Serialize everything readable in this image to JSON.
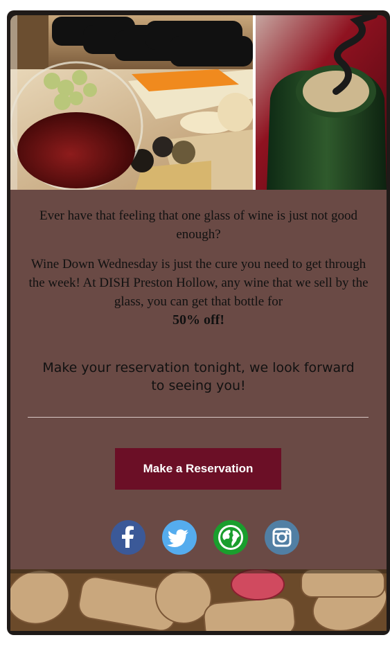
{
  "email": {
    "intro": "Ever have that feeling that one glass of wine is just not good enough?",
    "body": "Wine Down Wednesday is just the cure you need to get through the week! At DISH Preston Hollow, any wine that we sell by the glass, you can get that bottle for",
    "offer": "50% off!",
    "closing": "Make your reservation tonight, we look forward to seeing you!",
    "cta_label": "Make a Reservation"
  },
  "social": [
    {
      "name": "facebook-icon",
      "color": "#3b5998"
    },
    {
      "name": "twitter-icon",
      "color": "#55acee"
    },
    {
      "name": "website-globe-icon",
      "color": "#1a9e2d"
    },
    {
      "name": "instagram-icon",
      "color": "#517fa4"
    }
  ],
  "colors": {
    "frame": "#1f1a18",
    "panel": "#6a4a45",
    "button": "#6b0f26"
  }
}
